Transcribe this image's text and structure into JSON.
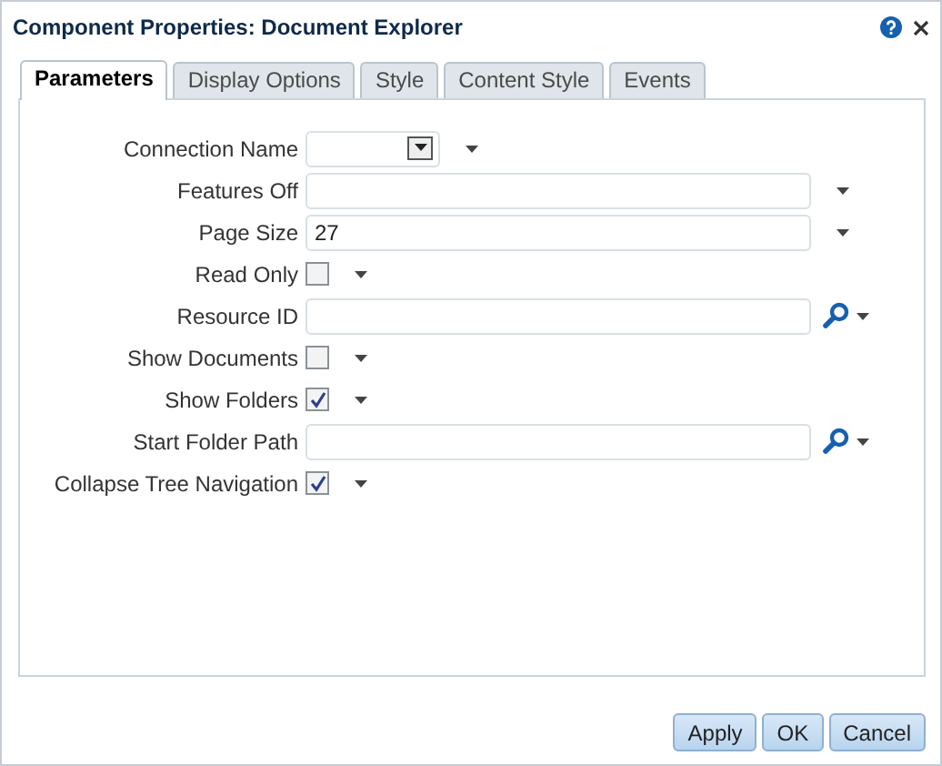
{
  "window": {
    "title": "Component Properties: Document Explorer"
  },
  "tabs": [
    {
      "label": "Parameters",
      "selected": true
    },
    {
      "label": "Display Options",
      "selected": false
    },
    {
      "label": "Style",
      "selected": false
    },
    {
      "label": "Content Style",
      "selected": false
    },
    {
      "label": "Events",
      "selected": false
    }
  ],
  "parameters": [
    {
      "label": "Connection Name",
      "kind": "select"
    },
    {
      "label": "Features Off",
      "kind": "text"
    },
    {
      "label": "Page Size",
      "kind": "text",
      "value": "27"
    },
    {
      "label": "Read Only",
      "kind": "checkbox",
      "checked": false
    },
    {
      "label": "Resource ID",
      "kind": "search"
    },
    {
      "label": "Show Documents",
      "kind": "checkbox",
      "checked": false
    },
    {
      "label": "Show Folders",
      "kind": "checkbox",
      "checked": true
    },
    {
      "label": "Start Folder Path",
      "kind": "search"
    },
    {
      "label": "Collapse Tree Navigation",
      "kind": "checkbox",
      "checked": true
    }
  ],
  "buttons": [
    "Apply",
    "OK",
    "Cancel"
  ]
}
